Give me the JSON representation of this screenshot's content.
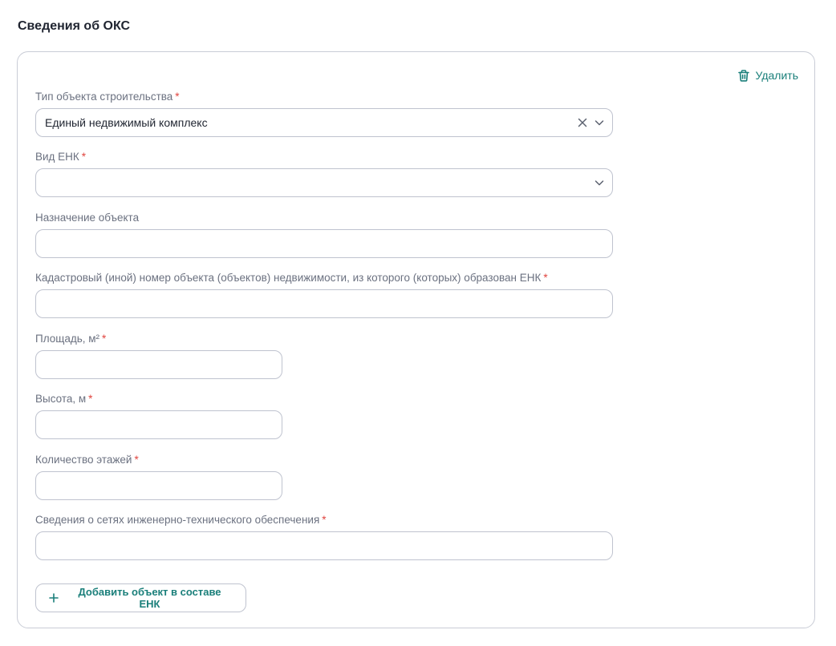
{
  "section": {
    "title": "Сведения об ОКС"
  },
  "card": {
    "delete_label": "Удалить",
    "fields": {
      "object_type": {
        "label": "Тип объекта строительства",
        "required_mark": "*",
        "value": "Единый недвижимый комплекс"
      },
      "enk_kind": {
        "label": "Вид ЕНК",
        "required_mark": "*",
        "value": ""
      },
      "purpose": {
        "label": "Назначение объекта",
        "value": ""
      },
      "cadastral_number": {
        "label": "Кадастровый (иной) номер объекта (объектов) недвижимости, из которого (которых) образован ЕНК",
        "required_mark": "*",
        "value": ""
      },
      "area": {
        "label": "Площадь, м²",
        "required_mark": "*",
        "value": ""
      },
      "height": {
        "label": "Высота, м",
        "required_mark": "*",
        "value": ""
      },
      "floors": {
        "label": "Количество этажей",
        "required_mark": "*",
        "value": ""
      },
      "networks": {
        "label": "Сведения о сетях инженерно-технического обеспечения",
        "required_mark": "*",
        "value": ""
      }
    },
    "add_button_label": "Добавить объект в составе ЕНК"
  },
  "colors": {
    "accent": "#1a7f7a",
    "required": "#e0443e",
    "border": "#bfc3cf",
    "label": "#6b7180",
    "text": "#1f2430"
  },
  "icons": {
    "delete": "trash-icon",
    "clear": "close-icon",
    "dropdown": "chevron-down-icon",
    "add": "plus-icon"
  }
}
